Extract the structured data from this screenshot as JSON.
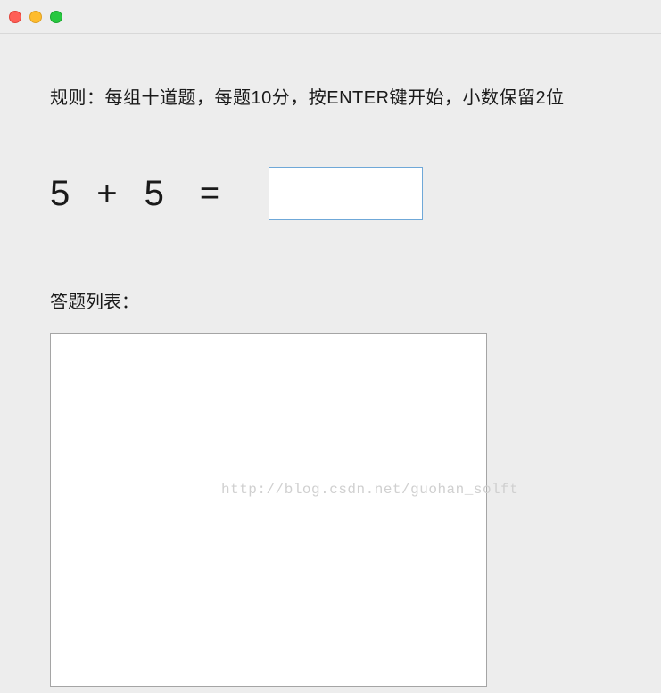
{
  "titlebar": {
    "close": "close",
    "minimize": "minimize",
    "maximize": "maximize"
  },
  "rules_text": "规则：每组十道题，每题10分，按ENTER键开始，小数保留2位",
  "equation": {
    "operand_a": "5",
    "operator": "+",
    "operand_b": "5",
    "equals": "="
  },
  "answer_input_value": "",
  "list_label": "答题列表：",
  "answer_list_content": "",
  "watermark": "http://blog.csdn.net/guohan_solft"
}
